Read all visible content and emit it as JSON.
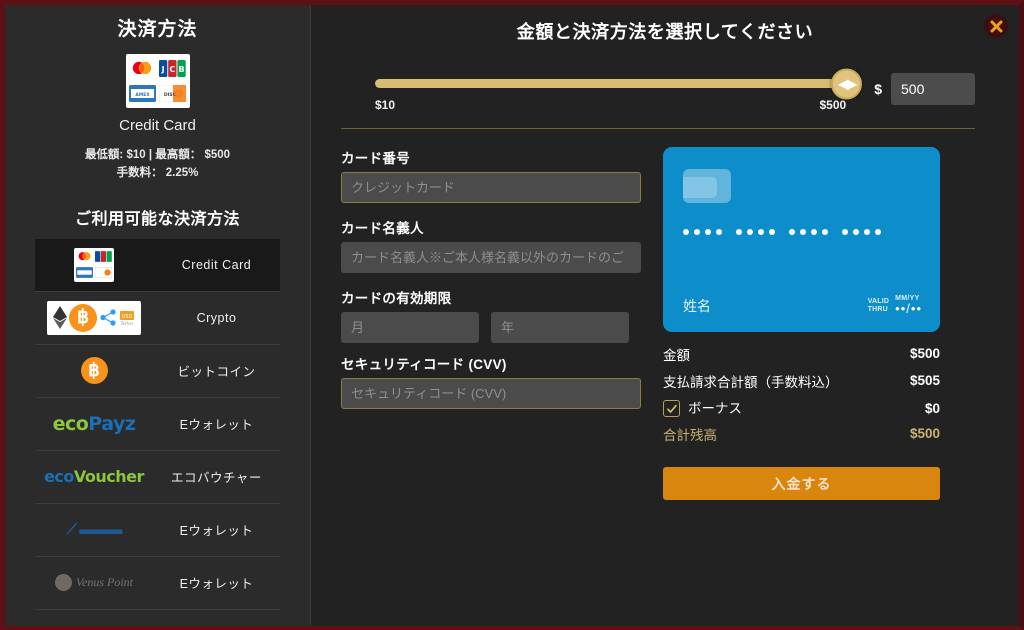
{
  "sidebar": {
    "title": "決済方法",
    "hero": {
      "logo_name": "credit-card-brands-logo",
      "label": "Credit Card",
      "limits": "最低額: $10 | 最高額： $500",
      "fee": "手数料： 2.25%"
    },
    "subtitle": "ご利用可能な決済方法",
    "methods": [
      {
        "label": "Credit Card",
        "logo": "credit-card-brands-logo",
        "selected": true
      },
      {
        "label": "Crypto",
        "logo": "crypto-coins-logo",
        "selected": false
      },
      {
        "label": "ビットコイン",
        "logo": "bitcoin-icon",
        "selected": false
      },
      {
        "label": "Eウォレット",
        "logo": "ecopayz-logo",
        "selected": false
      },
      {
        "label": "エコバウチャー",
        "logo": "ecovoucher-logo",
        "selected": false
      },
      {
        "label": "Eウォレット",
        "logo": "ewallet-logo",
        "selected": false
      },
      {
        "label": "Eウォレット",
        "logo": "venus-point-logo",
        "selected": false
      }
    ]
  },
  "main": {
    "title": "金額と決済方法を選択してください",
    "close_icon": "close-icon",
    "slider": {
      "min_label": "$10",
      "max_label": "$500",
      "value_percent": 100,
      "knob_icon": "left-right-arrows-icon"
    },
    "amount": {
      "currency_symbol": "$",
      "value": "500",
      "placeholder": "500"
    },
    "form": {
      "card_number": {
        "label": "カード番号",
        "value": "",
        "placeholder": "クレジットカード"
      },
      "card_holder": {
        "label": "カード名義人",
        "value": "",
        "placeholder": "カード名義人※ご本人様名義以外のカードのご"
      },
      "expiry": {
        "label": "カードの有効期限",
        "month": {
          "value": "",
          "placeholder": "月"
        },
        "year": {
          "value": "",
          "placeholder": "年"
        }
      },
      "cvv": {
        "label": "セキュリティコード (CVV)",
        "value": "",
        "placeholder": "セキュリティコード (CVV)"
      }
    },
    "card_preview": {
      "name_placeholder": "姓名",
      "valid_thru_line1": "VALID",
      "valid_thru_line2": "THRU",
      "mmyy_label": "MM/YY",
      "mmyy_value": "••/••"
    },
    "summary": {
      "rows": [
        {
          "label": "金額",
          "value": "$500",
          "style": "normal"
        },
        {
          "label": "支払請求合計額（手数料込）",
          "value": "$505",
          "style": "normal"
        }
      ],
      "bonus": {
        "label": "ボーナス",
        "value": "$0",
        "checked": true,
        "check_icon": "check-icon"
      },
      "total": {
        "label": "合計残高",
        "value": "$500"
      },
      "deposit_button": "入金する"
    }
  },
  "colors": {
    "accent_gold": "#d7bc74",
    "deposit_orange": "#d9860e",
    "card_blue": "#0d8ecb",
    "border_red": "#5e1015",
    "panel_bg": "#222222",
    "sidebar_bg": "#2b2b2b"
  }
}
